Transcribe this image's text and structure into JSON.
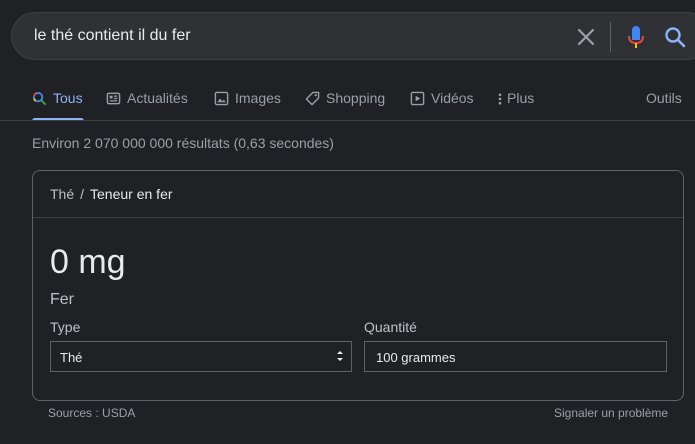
{
  "search": {
    "query": "le thé contient il du fer",
    "icons": [
      "clear-icon",
      "microphone-icon",
      "search-icon"
    ]
  },
  "tabs": [
    {
      "label": "Tous",
      "icon": "search-icon",
      "active": true
    },
    {
      "label": "Actualités",
      "icon": "news-icon"
    },
    {
      "label": "Images",
      "icon": "image-icon"
    },
    {
      "label": "Shopping",
      "icon": "tag-icon"
    },
    {
      "label": "Vidéos",
      "icon": "play-icon"
    },
    {
      "label": "Plus",
      "icon": "more-vert-icon"
    }
  ],
  "tools_label": "Outils",
  "stats": "Environ 2 070 000 000 résultats (0,63 secondes)",
  "card": {
    "breadcrumb": {
      "item": "Thé",
      "separator": "/",
      "current": "Teneur en fer"
    },
    "value": "0 mg",
    "nutrient": "Fer",
    "type_label": "Type",
    "type_value": "Thé",
    "quantity_label": "Quantité",
    "quantity_value": "100 grammes"
  },
  "sources": "Sources : USDA",
  "report": "Signaler un problème",
  "colors": {
    "background": "#202124",
    "accent": "#8ab4f8",
    "text": "#bdc1c6"
  }
}
